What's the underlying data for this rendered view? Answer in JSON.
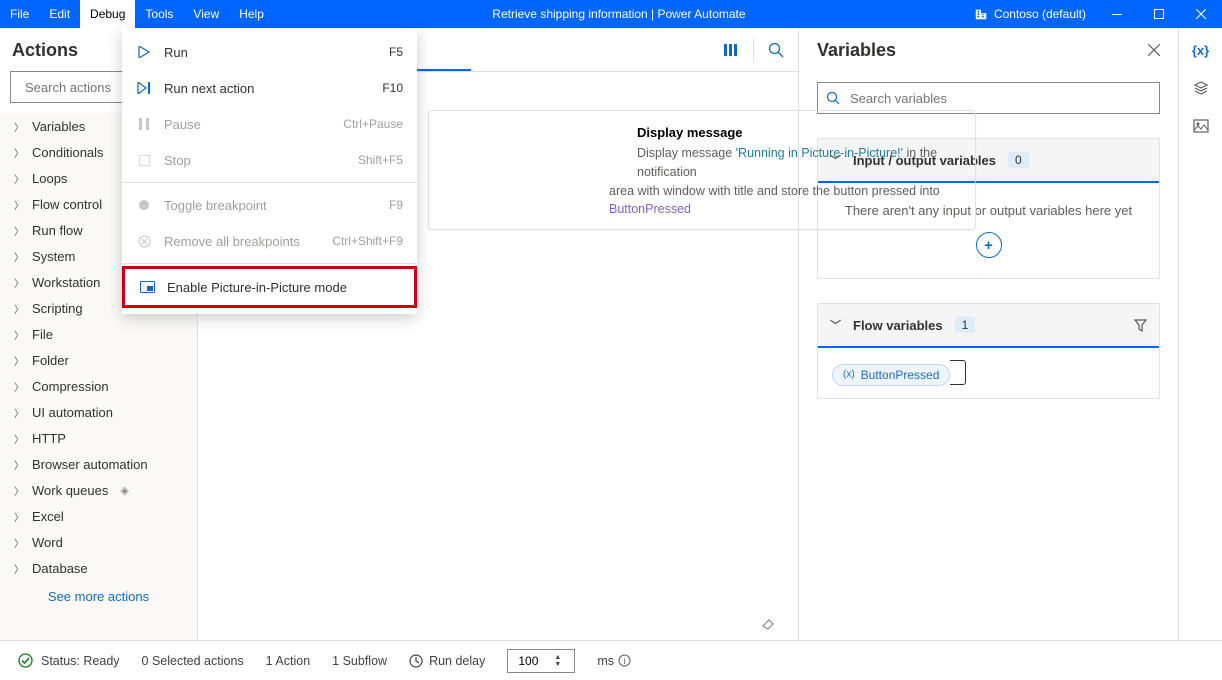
{
  "titlebar": {
    "menus": [
      "File",
      "Edit",
      "Debug",
      "Tools",
      "View",
      "Help"
    ],
    "active_menu": "Debug",
    "title": "Retrieve shipping information | Power Automate",
    "workspace": "Contoso (default)"
  },
  "debug_menu": {
    "items": [
      {
        "icon": "play",
        "label": "Run",
        "accel": "F5",
        "disabled": false
      },
      {
        "icon": "step",
        "label": "Run next action",
        "accel": "F10",
        "disabled": false
      },
      {
        "icon": "pause",
        "label": "Pause",
        "accel": "Ctrl+Pause",
        "disabled": true
      },
      {
        "icon": "stop",
        "label": "Stop",
        "accel": "Shift+F5",
        "disabled": true
      },
      {
        "icon": "dot",
        "label": "Toggle breakpoint",
        "accel": "F9",
        "disabled": true
      },
      {
        "icon": "x",
        "label": "Remove all breakpoints",
        "accel": "Ctrl+Shift+F9",
        "disabled": true
      },
      {
        "icon": "pip",
        "label": "Enable Picture-in-Picture mode",
        "accel": "",
        "disabled": false,
        "highlighted": true
      }
    ]
  },
  "actions": {
    "title": "Actions",
    "search_placeholder": "Search actions",
    "categories": [
      "Variables",
      "Conditionals",
      "Loops",
      "Flow control",
      "Run flow",
      "System",
      "Workstation",
      "Scripting",
      "File",
      "Folder",
      "Compression",
      "UI automation",
      "HTTP",
      "Browser automation",
      "Work queues",
      "Excel",
      "Word",
      "Database"
    ],
    "premium_category": "Work queues",
    "see_more": "See more actions"
  },
  "editor": {
    "tab": "",
    "card": {
      "title": "Display message",
      "line1_a": "Display message ",
      "line1_b": "'Running in Picture-in-Picture!'",
      "line1_c": " in the notification",
      "line2": "area with window with title  and store the button pressed into ",
      "var": "ButtonPressed"
    }
  },
  "variables": {
    "title": "Variables",
    "search_placeholder": "Search variables",
    "io": {
      "title": "Input / output variables",
      "count": "0",
      "empty": "There aren't any input or output variables here yet"
    },
    "flow": {
      "title": "Flow variables",
      "count": "1",
      "chip": "ButtonPressed"
    }
  },
  "status": {
    "text": "Status: Ready",
    "selected": "0 Selected actions",
    "actions": "1 Action",
    "subflows": "1 Subflow",
    "delay_label": "Run delay",
    "delay_value": "100",
    "delay_unit": "ms"
  }
}
